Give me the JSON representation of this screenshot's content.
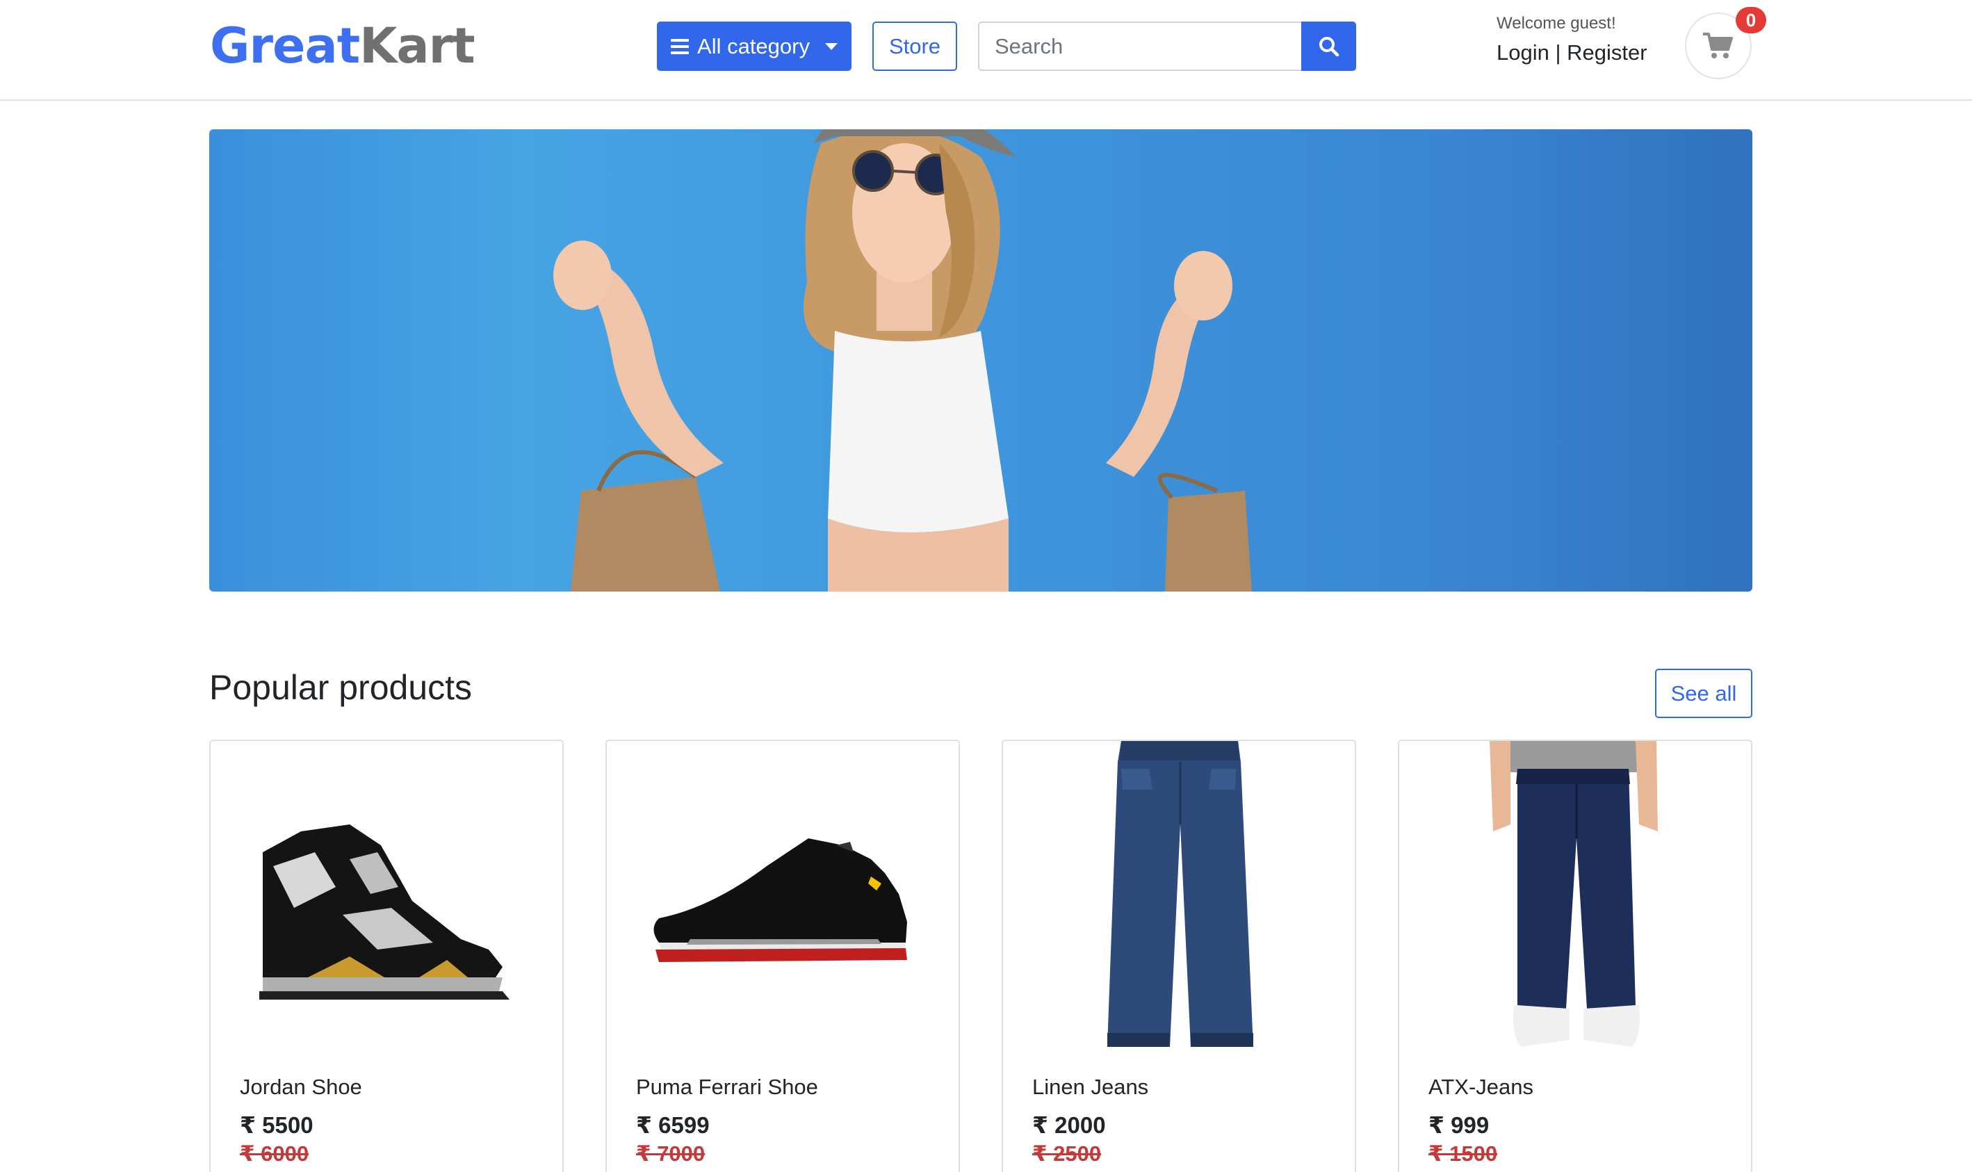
{
  "header": {
    "logo_part1": "Great",
    "logo_part2": "Kart",
    "category_label": "All category",
    "store_label": "Store",
    "search_placeholder": "Search",
    "welcome_text": "Welcome guest!",
    "login_label": "Login",
    "separator": " | ",
    "register_label": "Register",
    "cart_count": "0"
  },
  "hero": {
    "image": "woman-with-shopping-bags-banner"
  },
  "section": {
    "title": "Popular products",
    "see_all_label": "See all"
  },
  "products": [
    {
      "name": "Jordan Shoe",
      "price": "₹ 5500",
      "old_price": "₹ 6000",
      "image": "sneaker-icon"
    },
    {
      "name": "Puma Ferrari Shoe",
      "price": "₹ 6599",
      "old_price": "₹ 7000",
      "image": "shoe-icon"
    },
    {
      "name": "Linen Jeans",
      "price": "₹ 2000",
      "old_price": "₹ 2500",
      "image": "jeans-icon"
    },
    {
      "name": "ATX-Jeans",
      "price": "₹ 999",
      "old_price": "₹ 1500",
      "image": "jeans-model-icon"
    }
  ],
  "colors": {
    "primary": "#3167eb",
    "logo_blue": "#3d6ff0",
    "logo_gray": "#707070",
    "badge_red": "#e53935",
    "old_price_red": "#c43a3a"
  }
}
